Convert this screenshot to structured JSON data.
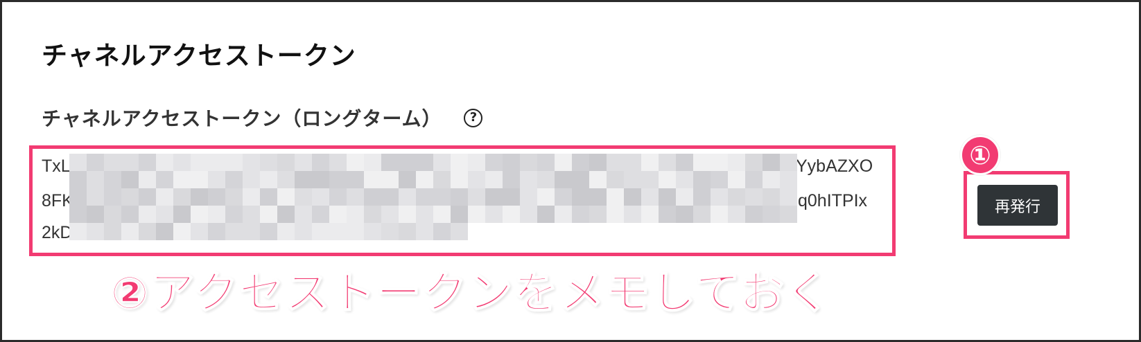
{
  "channel_token_section": {
    "title": "チャネルアクセストークン",
    "field_label": "チャネルアクセストークン（ロングターム）",
    "help_icon_glyph": "?",
    "token": {
      "line1_start": "TxL",
      "line1_end": "YybAZXO",
      "line2_start": "8FK",
      "line2_end": "q0hITPIx",
      "line3_start": "2kD"
    },
    "reissue_button_label": "再発行"
  },
  "annotations": {
    "step_one_marker": "①",
    "step_two_caption": "②アクセストークンをメモしておく",
    "highlight_color": "#f23b72"
  }
}
